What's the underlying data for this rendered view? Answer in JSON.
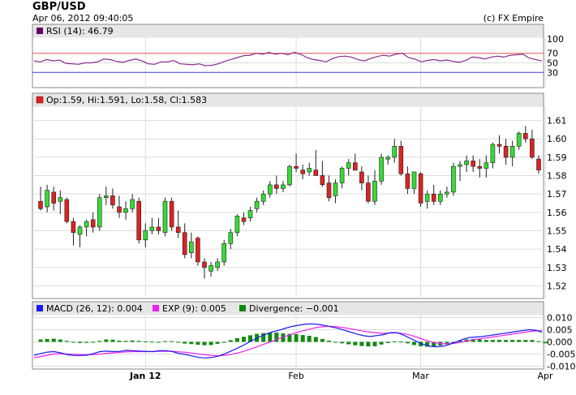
{
  "header": {
    "pair": "GBP/USD",
    "timestamp": "Apr 06, 2012 09:40:05",
    "copyright": "(c) FX Empire"
  },
  "colors": {
    "rsi_legend": "#660066",
    "rsi_line": "#8b2a8b",
    "rsi_upper": "#e05050",
    "rsi_lower": "#3a3ad8",
    "up": "#33dd33",
    "down": "#dd2222",
    "macd": "#1a1aee",
    "exp": "#ee22ee",
    "divergence": "#118811",
    "grid": "#dcdcdc"
  },
  "chart_data": [
    {
      "type": "line",
      "panel": "rsi",
      "legend": "RSI (14): 46.79",
      "yticks": [
        "100",
        "70",
        "50",
        "30"
      ],
      "ylim": [
        0,
        100
      ],
      "levels": [
        70,
        30
      ],
      "values": [
        54,
        52,
        57,
        54,
        56,
        49,
        48,
        47,
        50,
        50,
        52,
        58,
        57,
        53,
        51,
        55,
        58,
        54,
        48,
        47,
        52,
        52,
        55,
        48,
        47,
        46,
        48,
        44,
        45,
        48,
        53,
        57,
        61,
        65,
        66,
        70,
        68,
        72,
        68,
        70,
        67,
        72,
        68,
        61,
        57,
        55,
        52,
        59,
        63,
        64,
        62,
        57,
        54,
        59,
        63,
        66,
        64,
        68,
        70,
        61,
        58,
        52,
        55,
        57,
        54,
        56,
        53,
        51,
        55,
        62,
        61,
        58,
        62,
        64,
        62,
        66,
        67,
        68,
        60,
        57,
        54
      ],
      "grid": true
    },
    {
      "type": "candlestick",
      "panel": "price",
      "legend": "Op:1.59, Hi:1.591, Lo:1.58, Cl:1.583",
      "yticks": [
        "1.61",
        "1.60",
        "1.59",
        "1.58",
        "1.57",
        "1.56",
        "1.55",
        "1.54",
        "1.53",
        "1.52"
      ],
      "ylim": [
        1.514,
        1.616
      ],
      "candles": [
        [
          1.566,
          1.574,
          1.561,
          1.562
        ],
        [
          1.563,
          1.575,
          1.56,
          1.572
        ],
        [
          1.571,
          1.574,
          1.561,
          1.565
        ],
        [
          1.566,
          1.572,
          1.559,
          1.568
        ],
        [
          1.567,
          1.568,
          1.554,
          1.555
        ],
        [
          1.555,
          1.557,
          1.542,
          1.549
        ],
        [
          1.548,
          1.553,
          1.541,
          1.552
        ],
        [
          1.552,
          1.556,
          1.547,
          1.555
        ],
        [
          1.556,
          1.56,
          1.549,
          1.552
        ],
        [
          1.552,
          1.57,
          1.55,
          1.568
        ],
        [
          1.568,
          1.574,
          1.564,
          1.569
        ],
        [
          1.569,
          1.573,
          1.562,
          1.564
        ],
        [
          1.563,
          1.569,
          1.557,
          1.56
        ],
        [
          1.56,
          1.566,
          1.556,
          1.562
        ],
        [
          1.562,
          1.57,
          1.56,
          1.567
        ],
        [
          1.566,
          1.568,
          1.543,
          1.545
        ],
        [
          1.545,
          1.554,
          1.541,
          1.55
        ],
        [
          1.55,
          1.557,
          1.548,
          1.552
        ],
        [
          1.552,
          1.557,
          1.548,
          1.55
        ],
        [
          1.549,
          1.568,
          1.547,
          1.566
        ],
        [
          1.566,
          1.568,
          1.55,
          1.552
        ],
        [
          1.552,
          1.561,
          1.546,
          1.549
        ],
        [
          1.549,
          1.554,
          1.535,
          1.537
        ],
        [
          1.538,
          1.549,
          1.535,
          1.544
        ],
        [
          1.546,
          1.547,
          1.531,
          1.533
        ],
        [
          1.533,
          1.535,
          1.524,
          1.53
        ],
        [
          1.528,
          1.533,
          1.525,
          1.531
        ],
        [
          1.53,
          1.535,
          1.528,
          1.533
        ],
        [
          1.533,
          1.545,
          1.531,
          1.543
        ],
        [
          1.543,
          1.551,
          1.54,
          1.549
        ],
        [
          1.549,
          1.559,
          1.547,
          1.558
        ],
        [
          1.557,
          1.56,
          1.553,
          1.555
        ],
        [
          1.557,
          1.563,
          1.555,
          1.561
        ],
        [
          1.562,
          1.568,
          1.56,
          1.566
        ],
        [
          1.566,
          1.572,
          1.564,
          1.57
        ],
        [
          1.57,
          1.577,
          1.568,
          1.575
        ],
        [
          1.575,
          1.58,
          1.57,
          1.573
        ],
        [
          1.573,
          1.577,
          1.571,
          1.575
        ],
        [
          1.575,
          1.586,
          1.574,
          1.585
        ],
        [
          1.585,
          1.592,
          1.582,
          1.584
        ],
        [
          1.583,
          1.586,
          1.578,
          1.581
        ],
        [
          1.582,
          1.587,
          1.58,
          1.584
        ],
        [
          1.583,
          1.594,
          1.581,
          1.58
        ],
        [
          1.58,
          1.588,
          1.574,
          1.575
        ],
        [
          1.576,
          1.58,
          1.566,
          1.568
        ],
        [
          1.569,
          1.578,
          1.565,
          1.576
        ],
        [
          1.576,
          1.585,
          1.573,
          1.584
        ],
        [
          1.584,
          1.589,
          1.58,
          1.587
        ],
        [
          1.587,
          1.592,
          1.583,
          1.583
        ],
        [
          1.582,
          1.585,
          1.572,
          1.576
        ],
        [
          1.576,
          1.58,
          1.565,
          1.566
        ],
        [
          1.566,
          1.583,
          1.564,
          1.577
        ],
        [
          1.577,
          1.592,
          1.575,
          1.59
        ],
        [
          1.589,
          1.591,
          1.586,
          1.59
        ],
        [
          1.59,
          1.6,
          1.587,
          1.596
        ],
        [
          1.596,
          1.599,
          1.58,
          1.581
        ],
        [
          1.581,
          1.585,
          1.57,
          1.573
        ],
        [
          1.573,
          1.582,
          1.57,
          1.582
        ],
        [
          1.581,
          1.582,
          1.563,
          1.565
        ],
        [
          1.566,
          1.572,
          1.562,
          1.57
        ],
        [
          1.57,
          1.575,
          1.564,
          1.566
        ],
        [
          1.566,
          1.572,
          1.564,
          1.57
        ],
        [
          1.57,
          1.574,
          1.568,
          1.571
        ],
        [
          1.571,
          1.587,
          1.569,
          1.585
        ],
        [
          1.585,
          1.588,
          1.577,
          1.586
        ],
        [
          1.586,
          1.591,
          1.582,
          1.588
        ],
        [
          1.588,
          1.591,
          1.582,
          1.585
        ],
        [
          1.585,
          1.589,
          1.579,
          1.584
        ],
        [
          1.584,
          1.591,
          1.579,
          1.587
        ],
        [
          1.587,
          1.598,
          1.584,
          1.597
        ],
        [
          1.597,
          1.602,
          1.592,
          1.596
        ],
        [
          1.596,
          1.6,
          1.586,
          1.59
        ],
        [
          1.59,
          1.599,
          1.585,
          1.596
        ],
        [
          1.596,
          1.604,
          1.594,
          1.603
        ],
        [
          1.603,
          1.607,
          1.598,
          1.6
        ],
        [
          1.6,
          1.605,
          1.589,
          1.59
        ],
        [
          1.589,
          1.591,
          1.581,
          1.583
        ]
      ],
      "grid": true
    },
    {
      "type": "line",
      "panel": "macd",
      "legend": [
        {
          "name": "MACD (26, 12): 0.004",
          "color_key": "macd"
        },
        {
          "name": "EXP (9): 0.005",
          "color_key": "exp"
        },
        {
          "name": "Divergence: −0.001",
          "color_key": "divergence"
        }
      ],
      "yticks": [
        "0.010",
        "0.005",
        "0.000",
        "-0.005",
        "-0.010"
      ],
      "ylim": [
        -0.0105,
        0.0105
      ],
      "series": [
        {
          "name": "MACD (26, 12): 0.004",
          "color_key": "macd",
          "values": [
            -0.0055,
            -0.0048,
            -0.0042,
            -0.004,
            -0.0045,
            -0.0052,
            -0.0056,
            -0.0056,
            -0.0055,
            -0.0048,
            -0.004,
            -0.0038,
            -0.004,
            -0.0039,
            -0.0035,
            -0.0036,
            -0.0038,
            -0.0039,
            -0.004,
            -0.0036,
            -0.0036,
            -0.004,
            -0.0048,
            -0.0052,
            -0.0058,
            -0.0064,
            -0.0066,
            -0.0064,
            -0.0058,
            -0.0048,
            -0.0036,
            -0.0024,
            -0.001,
            0.0005,
            0.0018,
            0.003,
            0.004,
            0.0047,
            0.0055,
            0.0063,
            0.0068,
            0.0072,
            0.0074,
            0.0072,
            0.0068,
            0.0062,
            0.0056,
            0.0048,
            0.004,
            0.0032,
            0.0025,
            0.0022,
            0.0026,
            0.003,
            0.0038,
            0.0038,
            0.0028,
            0.0015,
            0.0002,
            -0.001,
            -0.0018,
            -0.002,
            -0.0018,
            -0.001,
            0.0,
            0.001,
            0.0018,
            0.002,
            0.0022,
            0.0026,
            0.003,
            0.0034,
            0.0038,
            0.0042,
            0.0046,
            0.005,
            0.0048,
            0.004
          ]
        },
        {
          "name": "EXP (9): 0.005",
          "color_key": "exp",
          "values": [
            -0.0065,
            -0.006,
            -0.0055,
            -0.005,
            -0.0049,
            -0.005,
            -0.0051,
            -0.0052,
            -0.0053,
            -0.0052,
            -0.005,
            -0.0047,
            -0.0045,
            -0.0043,
            -0.0041,
            -0.004,
            -0.004,
            -0.004,
            -0.004,
            -0.0039,
            -0.0039,
            -0.0039,
            -0.0041,
            -0.0043,
            -0.0046,
            -0.005,
            -0.0053,
            -0.0056,
            -0.0057,
            -0.0055,
            -0.0051,
            -0.0045,
            -0.0037,
            -0.0028,
            -0.0018,
            -0.0008,
            0.0002,
            0.0012,
            0.0022,
            0.0031,
            0.004,
            0.0047,
            0.0054,
            0.006,
            0.0063,
            0.0064,
            0.0062,
            0.0058,
            0.0054,
            0.0049,
            0.0044,
            0.004,
            0.0037,
            0.0035,
            0.0036,
            0.0037,
            0.0034,
            0.0028,
            0.002,
            0.001,
            0.0002,
            -0.0005,
            -0.0008,
            -0.0008,
            -0.0005,
            0.0,
            0.0006,
            0.001,
            0.0014,
            0.0018,
            0.0022,
            0.0026,
            0.003,
            0.0034,
            0.0038,
            0.0042,
            0.0045,
            0.0046
          ]
        },
        {
          "name": "Divergence: −0.001",
          "color_key": "divergence",
          "type": "bar",
          "values": [
            0.001,
            0.0012,
            0.0013,
            0.001,
            0.0004,
            -0.0002,
            -0.0005,
            -0.0004,
            -0.0002,
            0.0004,
            0.001,
            0.0009,
            0.0005,
            0.0004,
            0.0006,
            0.0004,
            0.0002,
            0.0001,
            0.0,
            0.0003,
            0.0003,
            -0.0001,
            -0.0007,
            -0.0009,
            -0.0012,
            -0.0014,
            -0.0013,
            -0.0008,
            -0.0001,
            0.0007,
            0.0015,
            0.0021,
            0.0027,
            0.0033,
            0.0036,
            0.0038,
            0.0038,
            0.0035,
            0.0033,
            0.0032,
            0.0028,
            0.0025,
            0.002,
            0.0012,
            0.0005,
            -0.0002,
            -0.0006,
            -0.001,
            -0.0014,
            -0.0017,
            -0.0019,
            -0.0018,
            -0.0011,
            -0.0005,
            0.0002,
            0.0001,
            -0.0006,
            -0.0013,
            -0.0018,
            -0.002,
            -0.002,
            -0.0015,
            -0.001,
            -0.0002,
            0.0005,
            0.001,
            0.0012,
            0.001,
            0.0008,
            0.0008,
            0.0008,
            0.0008,
            0.0008,
            0.0008,
            0.0008,
            0.0008,
            0.0003,
            -0.0006
          ]
        }
      ],
      "grid": true
    }
  ],
  "xaxis": {
    "labels": [
      {
        "text": "Jan 12",
        "bold": true,
        "index": 16
      },
      {
        "text": "Feb",
        "bold": false,
        "index": 39
      },
      {
        "text": "Mar",
        "bold": false,
        "index": 58
      },
      {
        "text": "Apr",
        "bold": false,
        "index": 77
      }
    ]
  }
}
